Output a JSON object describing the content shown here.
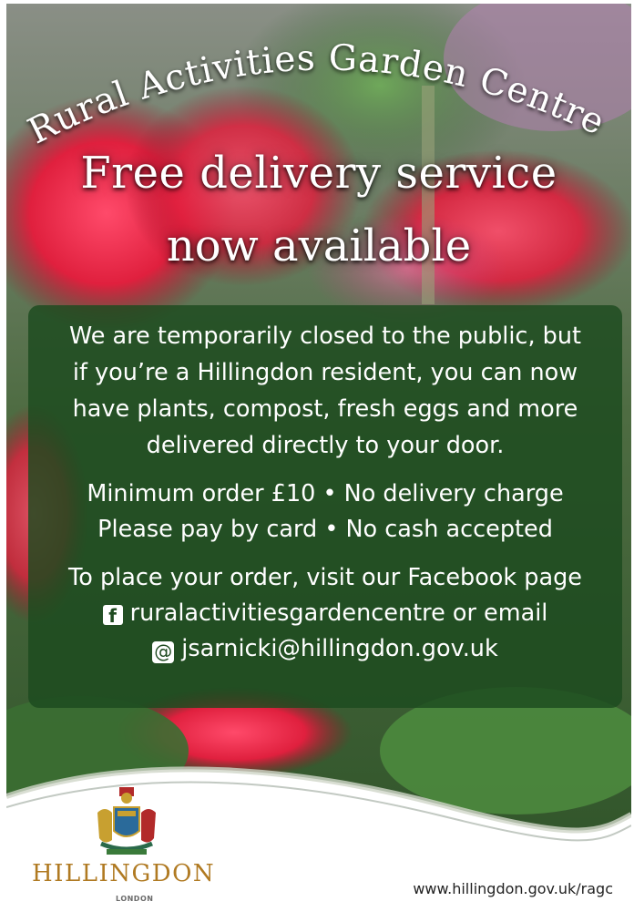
{
  "header": {
    "title": "Rural Activities Garden Centre",
    "headline_line1": "Free delivery service",
    "headline_line2": "now available"
  },
  "info": {
    "paragraph1": [
      "We are temporarily closed to the public, but",
      "if you’re a Hillingdon resident, you can now",
      "have plants, compost, fresh eggs and more",
      "delivered directly to your door."
    ],
    "order_line1": "Minimum order £10 • No delivery charge",
    "order_line2": "Please pay by card • No cash accepted",
    "contact_line1": "To place your order, visit our Facebook page",
    "facebook_text": "ruralactivitiesgardencentre or email",
    "email": "jsarnicki@hillingdon.gov.uk"
  },
  "footer": {
    "logo_name": "HILLINGDON",
    "logo_sub": "LONDON",
    "url": "www.hillingdon.gov.uk/ragc"
  },
  "icons": {
    "facebook": "facebook-icon",
    "email": "at-sign-icon",
    "crest": "coat-of-arms-icon"
  },
  "colors": {
    "panel": "#1c4a1e",
    "brand_gold": "#b07a22",
    "text": "#ffffff"
  }
}
